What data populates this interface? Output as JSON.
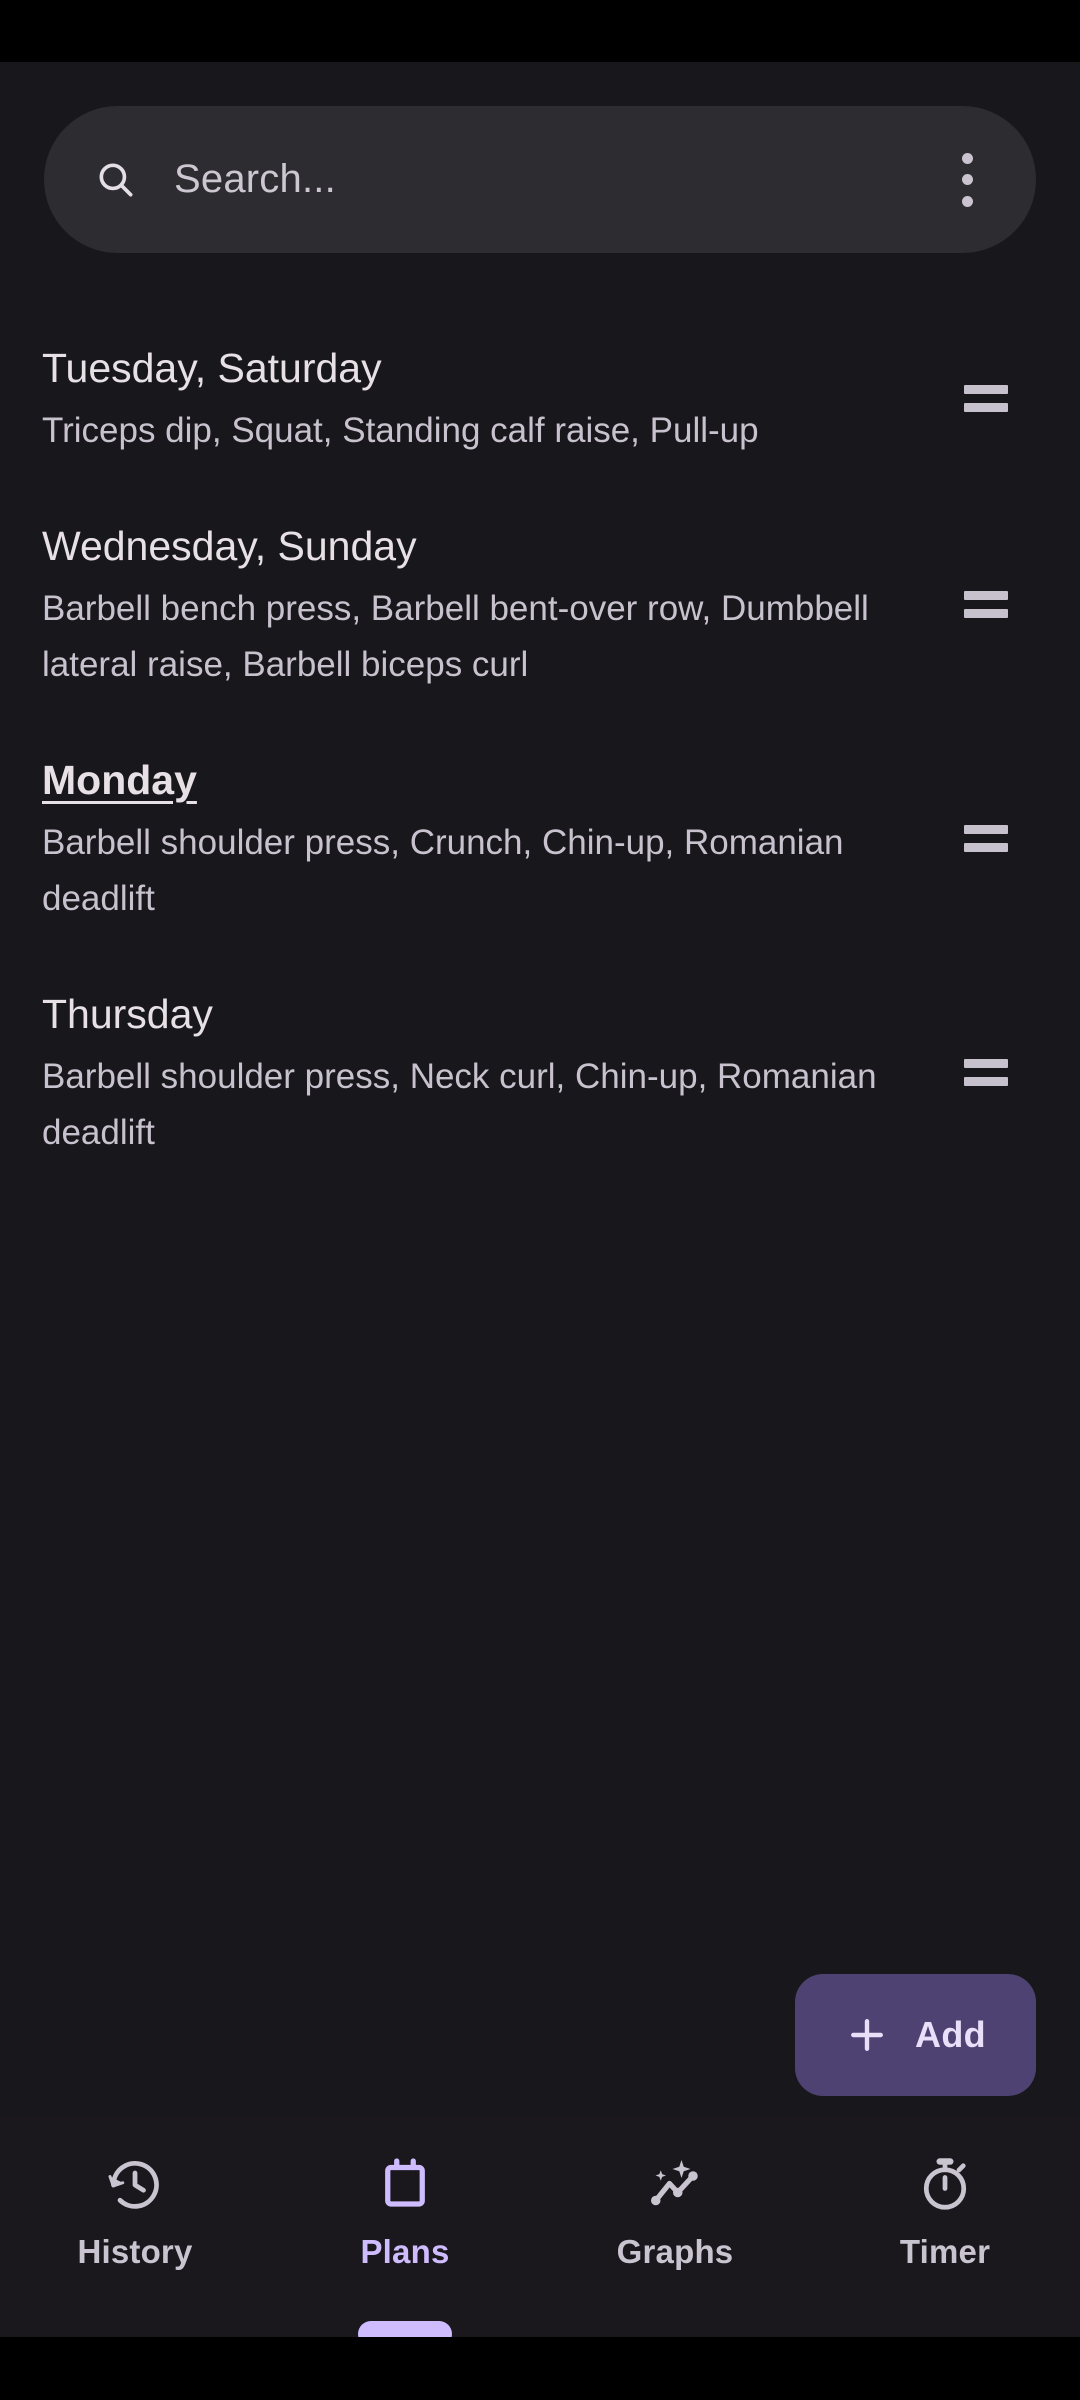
{
  "theme": {
    "background": "#18171B",
    "surface": "#2D2C31",
    "nav_background": "#1A181D",
    "accent": "#CFBCFF",
    "fab_background": "#4E4273",
    "fab_foreground": "#E9DFF8",
    "title_text": "#E7E1E6",
    "secondary_text": "#C8C2CE",
    "system_bar": "#000000"
  },
  "search": {
    "placeholder": "Search...",
    "value": "",
    "icon": "search-icon",
    "overflow_icon": "more-vertical-icon"
  },
  "plans": [
    {
      "title": "Tuesday, Saturday",
      "exercises": "Triceps dip,  Squat, Standing calf raise, Pull-up",
      "current": false,
      "handle_icon": "drag-handle-icon"
    },
    {
      "title": "Wednesday, Sunday",
      "exercises": "Barbell bench press, Barbell bent-over row, Dumbbell lateral raise, Barbell biceps curl",
      "current": false,
      "handle_icon": "drag-handle-icon"
    },
    {
      "title": "Monday",
      "exercises": "Barbell shoulder press, Crunch, Chin-up, Romanian deadlift",
      "current": true,
      "handle_icon": "drag-handle-icon"
    },
    {
      "title": "Thursday",
      "exercises": "Barbell shoulder press, Neck curl, Chin-up, Romanian deadlift",
      "current": false,
      "handle_icon": "drag-handle-icon"
    }
  ],
  "fab": {
    "label": "Add",
    "icon": "plus-icon"
  },
  "bottom_nav": {
    "active_index": 1,
    "items": [
      {
        "label": "History",
        "icon": "history-clock-icon",
        "active": false
      },
      {
        "label": "Plans",
        "icon": "calendar-icon",
        "active": true
      },
      {
        "label": "Graphs",
        "icon": "trending-sparkle-icon",
        "active": false
      },
      {
        "label": "Timer",
        "icon": "stopwatch-icon",
        "active": false
      }
    ]
  }
}
